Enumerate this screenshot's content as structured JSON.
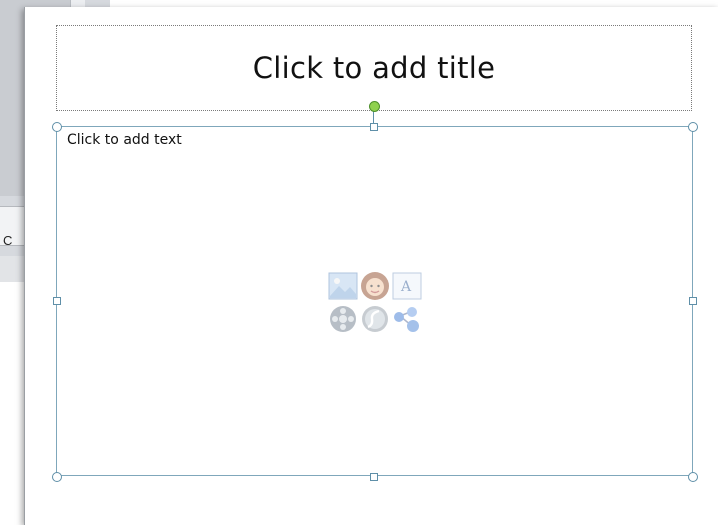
{
  "background_window": {
    "button_partial_label": "C"
  },
  "slide": {
    "title_placeholder": "Click to add title",
    "content_placeholder": "Click to add text",
    "insert_icons": [
      {
        "name": "insert-picture-icon"
      },
      {
        "name": "insert-clip-art-icon"
      },
      {
        "name": "insert-text-icon"
      },
      {
        "name": "insert-media-icon"
      },
      {
        "name": "insert-flash-icon"
      },
      {
        "name": "insert-smartart-icon"
      }
    ]
  },
  "colors": {
    "selection_border": "#7fa7bb",
    "rotate_handle": "#8fd14f",
    "slide_background": "#ffffff"
  }
}
